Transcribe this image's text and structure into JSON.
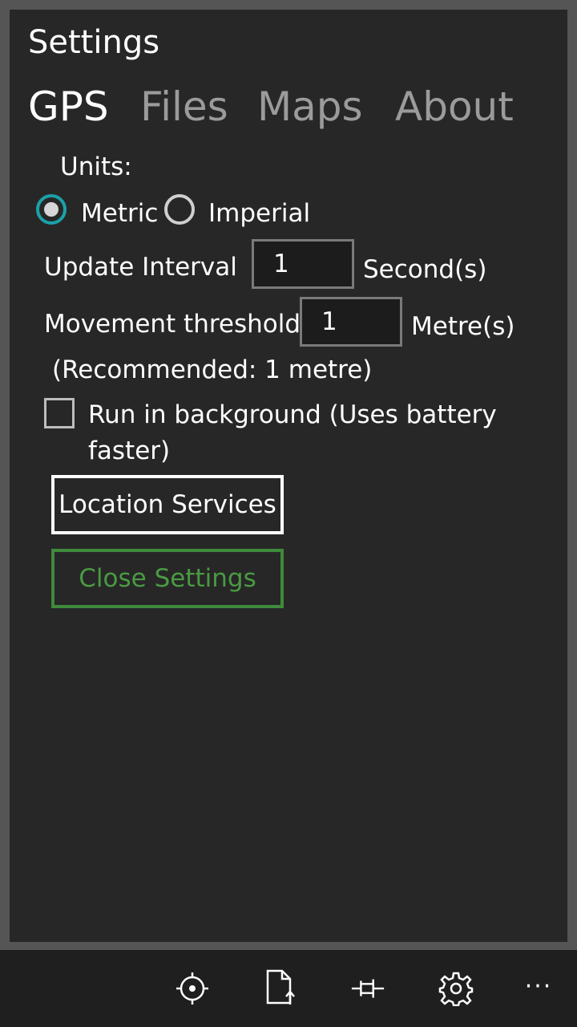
{
  "header": {
    "title": "Settings"
  },
  "tabs": [
    {
      "label": "GPS",
      "active": true
    },
    {
      "label": "Files",
      "active": false
    },
    {
      "label": "Maps",
      "active": false
    },
    {
      "label": "About",
      "active": false
    }
  ],
  "units": {
    "label": "Units:",
    "options": [
      {
        "label": "Metric",
        "checked": true
      },
      {
        "label": "Imperial",
        "checked": false
      }
    ]
  },
  "update_interval": {
    "label": "Update Interval",
    "value": "1",
    "unit": "Second(s)"
  },
  "movement_threshold": {
    "label": "Movement threshold",
    "value": "1",
    "unit": "Metre(s)",
    "note": "(Recommended: 1 metre)"
  },
  "background": {
    "label_line1": "Run in background (Uses battery",
    "label_line2": "faster)",
    "checked": false
  },
  "buttons": {
    "location_services": "Location Services",
    "close_settings": "Close Settings"
  },
  "appbar": {
    "icons": [
      "locate-icon",
      "file-upload-icon",
      "pin-icon",
      "settings-icon"
    ],
    "more": "···"
  },
  "colors": {
    "accent": "#1ba1a8",
    "close_green": "#4a9a42",
    "background": "#272727"
  }
}
